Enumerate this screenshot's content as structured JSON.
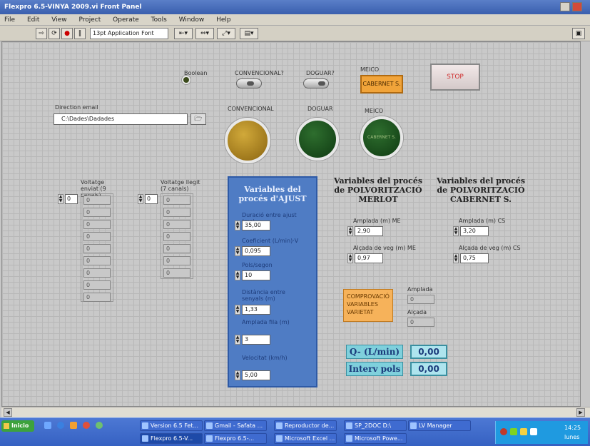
{
  "window": {
    "title": "Flexpro 6.5-VINYA 2009.vi Front Panel"
  },
  "menu": [
    "File",
    "Edit",
    "View",
    "Project",
    "Operate",
    "Tools",
    "Window",
    "Help"
  ],
  "toolbar": {
    "font": "13pt Application Font"
  },
  "controls": {
    "led_label": "Boolean",
    "switch_conv": "CONVENCIONAL?",
    "switch_doguar": "DOGUAR?",
    "meico_label": "MEICO",
    "meico_button": "CABERNET S.",
    "stop_button": "STOP",
    "path_label": "Direction email",
    "path_value": "C:\\Dades\\Dadades",
    "lamp_conv": "CONVENCIONAL",
    "lamp_doguar": "DOGUAR",
    "lamp_meico": "MEICO",
    "lamp_meico_text": "CABERNET S.",
    "voltage_sent_label": "Voltatge enviat (9 canals)",
    "voltage_sent_index": "0",
    "voltage_sent_values": [
      "0",
      "0",
      "0",
      "0",
      "0",
      "0",
      "0",
      "0",
      "0"
    ],
    "voltage_read_label": "Voltatge llegit (7 canals)",
    "voltage_read_index": "0",
    "voltage_read_values": [
      "0",
      "0",
      "0",
      "0",
      "0",
      "0",
      "0"
    ]
  },
  "ajust": {
    "title": "Variables del procés d'AJUST",
    "fields": [
      {
        "label": "Duració entre ajust (ms)",
        "value": "35,00"
      },
      {
        "label": "Coeficient (L/min)·V",
        "value": "0,095"
      },
      {
        "label": "Pols/segon",
        "value": "10"
      },
      {
        "label": "Distància entre senyals (m)",
        "value": "1,33"
      },
      {
        "label": "Amplada fila (m)",
        "value": "3"
      },
      {
        "label": "Velocitat (km/h)",
        "value": "5,00"
      }
    ]
  },
  "merlot": {
    "title": "Variables del procés de POLVORITZACIÓ MERLOT",
    "amplada_label": "Amplada (m) ME",
    "amplada_value": "2,90",
    "alcada_label": "Alçada de veg (m) ME",
    "alcada_value": "0,97"
  },
  "cabernet": {
    "title": "Variables del procés de POLVORITZACIÓ CABERNET S.",
    "amplada_label": "Amplada (m) CS",
    "amplada_value": "3,20",
    "alcada_label": "Alçada de veg (m) CS",
    "alcada_value": "0,75"
  },
  "comprovacio": {
    "button": "COMPROVACIÓ VARIABLES VARIETAT",
    "amplada_label": "Amplada",
    "amplada_value": "0",
    "alcada_label": "Alçada",
    "alcada_value": "0"
  },
  "outputs": [
    {
      "label": "Q- (L/min)",
      "value": "0,00"
    },
    {
      "label": "Interv pols",
      "value": "0,00"
    }
  ],
  "taskbar": {
    "start": "Inicio",
    "tasks_top": [
      "Version 6.5 Fet...",
      "Gmail - Safata ...",
      "Reproductor de...",
      "SP_2DOC D:\\",
      "LV Manager"
    ],
    "tasks_bottom": [
      "Flexpro 6.5-V...",
      "Flexpro 6.5-...",
      "Microsoft Excel ...",
      "Microsoft Powe..."
    ],
    "clock": "14:25",
    "day": "lunes"
  },
  "colors": {
    "ajust_panel": "#4f7cc4",
    "meico_btn": "#f1a43a",
    "compr_btn": "#f6b25a"
  }
}
